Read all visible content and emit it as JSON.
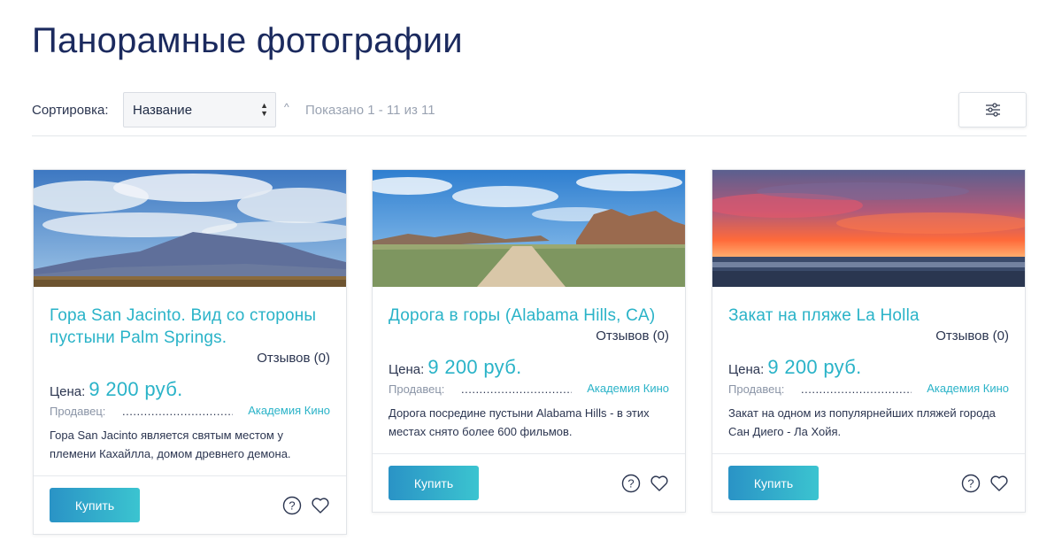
{
  "page": {
    "title": "Панорамные фотографии"
  },
  "toolbar": {
    "sort_label": "Сортировка:",
    "sort_value": "Название",
    "sort_arrows": "▲▼",
    "sort_direction_icon": "^",
    "shown_text": "Показано 1 - 11 из 11",
    "filter_icon": "sliders-icon"
  },
  "colors": {
    "accent": "#2ab3c8",
    "title": "#1b2a5e",
    "button_from": "#2a93c6",
    "button_to": "#3bc4d0"
  },
  "cards": [
    {
      "title": "Гора San Jacinto. Вид со стороны пустыни Palm Springs.",
      "reviews": "Отзывов (0)",
      "price_label": "Цена:",
      "price": "9 200 руб.",
      "seller_label": "Продавец:",
      "seller_dots": "..............................................",
      "seller_name": "Академия Кино",
      "description": "Гора San Jacinto является святым местом у племени Кахайлла, домом древнего демона.",
      "buy_label": "Купить"
    },
    {
      "title": "Дорога в горы (Alabama Hills, CA)",
      "reviews": "Отзывов (0)",
      "price_label": "Цена:",
      "price": "9 200 руб.",
      "seller_label": "Продавец:",
      "seller_dots": "..............................................",
      "seller_name": "Академия Кино",
      "description": "Дорога посредине пустыни Alabama Hills - в этих местах снято более 600 фильмов.",
      "buy_label": "Купить"
    },
    {
      "title": "Закат на пляже La Holla",
      "reviews": "Отзывов (0)",
      "price_label": "Цена:",
      "price": "9 200 руб.",
      "seller_label": "Продавец:",
      "seller_dots": "..............................................",
      "seller_name": "Академия Кино",
      "description": "Закат на одном из популярнейших пляжей города Сан Диего - Ла Хойя.",
      "buy_label": "Купить"
    }
  ]
}
